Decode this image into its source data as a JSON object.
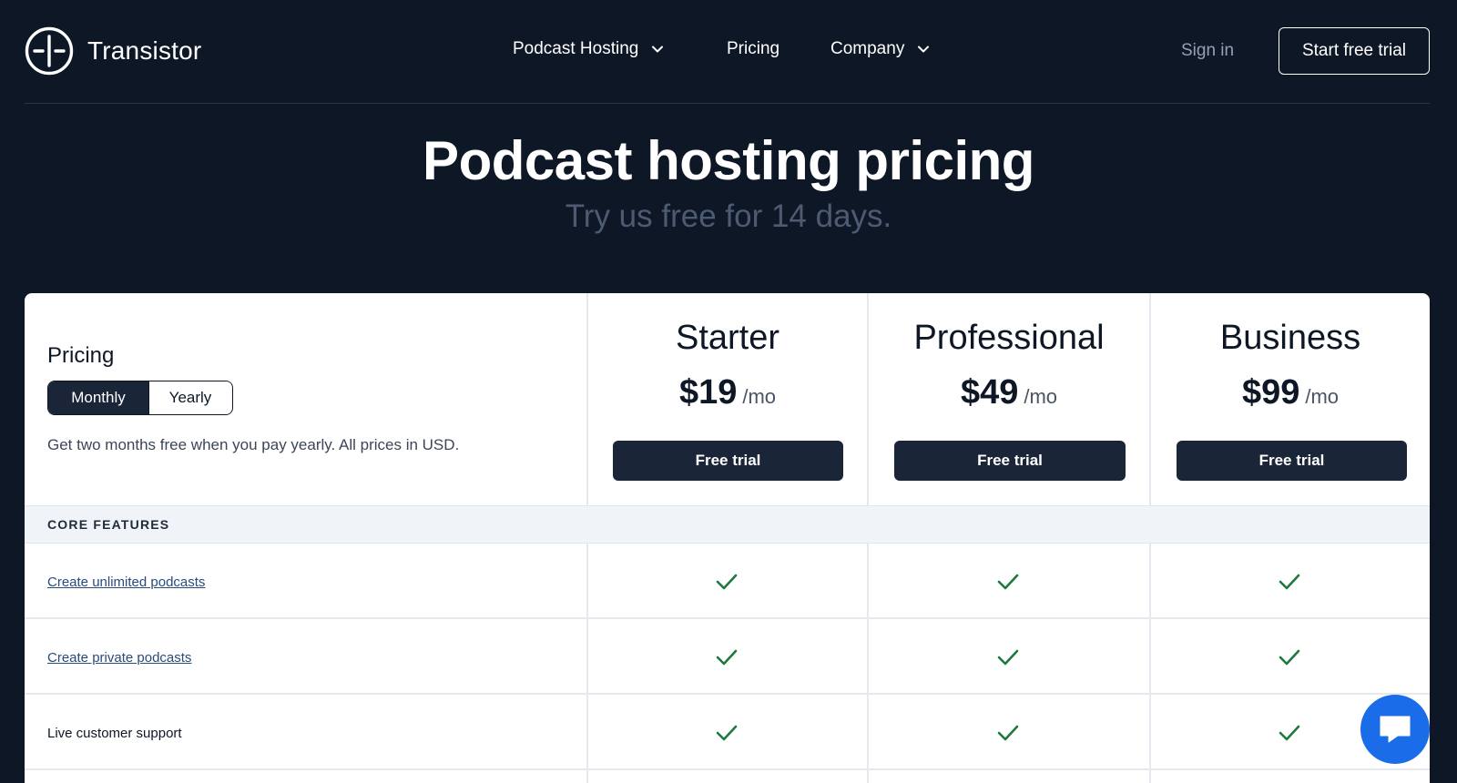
{
  "header": {
    "logo_text": "Transistor",
    "nav": [
      {
        "label": "Podcast Hosting",
        "has_dropdown": true,
        "icon": "chevron-down-icon"
      },
      {
        "label": "Pricing",
        "has_dropdown": false
      },
      {
        "label": "Company",
        "has_dropdown": true,
        "icon": "chevron-down-icon"
      }
    ],
    "signin_label": "Sign in",
    "cta_label": "Start free trial"
  },
  "hero": {
    "title": "Podcast hosting pricing",
    "subtitle": "Try us free for 14 days."
  },
  "pricing": {
    "title": "Pricing",
    "toggle": {
      "monthly": "Monthly",
      "yearly": "Yearly",
      "selected": "Monthly"
    },
    "note": "Get two months free when you pay yearly. All prices in USD.",
    "plans": [
      {
        "name": "Starter",
        "amount": "$19",
        "unit": "/mo",
        "button": "Free trial"
      },
      {
        "name": "Professional",
        "amount": "$49",
        "unit": "/mo",
        "button": "Free trial"
      },
      {
        "name": "Business",
        "amount": "$99",
        "unit": "/mo",
        "button": "Free trial"
      }
    ]
  },
  "features": {
    "section_label": "CORE FEATURES",
    "rows": [
      {
        "label": "Create unlimited podcasts",
        "link": true,
        "starter": true,
        "professional": true,
        "business": true
      },
      {
        "label": "Create private podcasts",
        "link": true,
        "starter": true,
        "professional": true,
        "business": true
      },
      {
        "label": "Live customer support",
        "link": false,
        "starter": true,
        "professional": true,
        "business": true
      }
    ]
  },
  "colors": {
    "background": "#0e1726",
    "button": "#1b2538",
    "check": "#1d7a3c",
    "chat": "#1a6ce8",
    "muted": "#4d5b72"
  },
  "chat_widget": {
    "icon": "chat-bubble-icon"
  }
}
